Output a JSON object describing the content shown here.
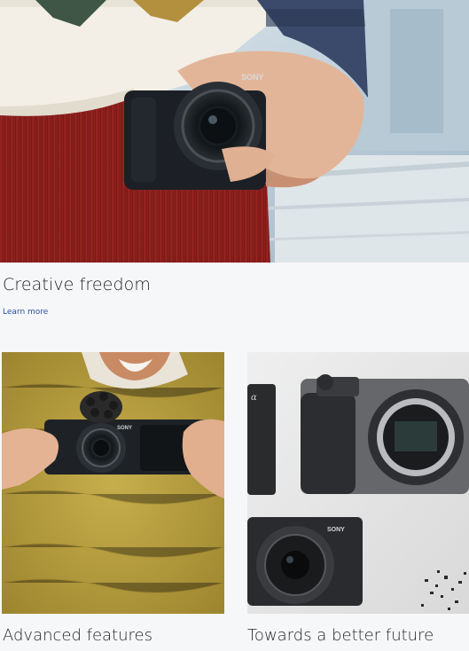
{
  "hero": {
    "title": "Creative freedom",
    "link_label": "Learn more",
    "camera_brand": "SONY"
  },
  "cards": [
    {
      "title": "Advanced features",
      "camera_brand": "SONY"
    },
    {
      "title": "Towards a better future",
      "camera_brand": "SONY"
    }
  ],
  "colors": {
    "page_background": "#f6f7f9",
    "link": "#2d4fa0",
    "text": "#262626"
  }
}
